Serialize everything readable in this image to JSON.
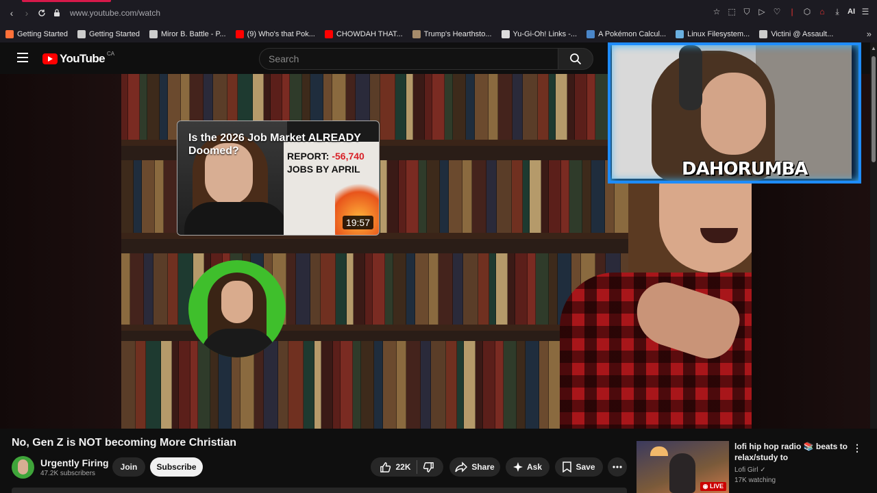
{
  "browser": {
    "url": "www.youtube.com/watch",
    "ai_label": "AI",
    "bookmarks": [
      {
        "label": "Getting Started",
        "color": "#ff7139"
      },
      {
        "label": "Getting Started",
        "color": "#cccccc"
      },
      {
        "label": "Miror B. Battle - P...",
        "color": "#cccccc"
      },
      {
        "label": "(9) Who's that Pok...",
        "color": "#ff0000"
      },
      {
        "label": "CHOWDAH THAT...",
        "color": "#ff0000"
      },
      {
        "label": "Trump's Hearthsto...",
        "color": "#a58b6b"
      },
      {
        "label": "Yu-Gi-Oh! Links -...",
        "color": "#dddddd"
      },
      {
        "label": "A Pokémon Calcul...",
        "color": "#4a86c8"
      },
      {
        "label": "Linux Filesystem...",
        "color": "#6ab0e0"
      },
      {
        "label": "Victini @ Assault...",
        "color": "#cccccc"
      }
    ]
  },
  "youtube": {
    "logo_text": "YouTube",
    "country_code": "CA",
    "search_placeholder": "Search"
  },
  "video": {
    "card": {
      "title": "Is the 2026 Job Market ALREADY Doomed?",
      "report_label": "REPORT:",
      "report_value": "-56,740",
      "report_sub": "JOBS BY APRIL",
      "duration": "19:57"
    },
    "webcam_name": "DAHORUMBA"
  },
  "below": {
    "title": "No, Gen Z is NOT becoming More Christian",
    "channel_name": "Urgently Firing",
    "subscribers": "47.2K subscribers",
    "join_label": "Join",
    "subscribe_label": "Subscribe",
    "likes": "22K",
    "share_label": "Share",
    "ask_label": "Ask",
    "save_label": "Save"
  },
  "recommendation": {
    "title": "lofi hip hop radio 📚 beats to relax/study to",
    "channel": "Lofi Girl",
    "watching": "17K watching",
    "badge": "LIVE"
  }
}
